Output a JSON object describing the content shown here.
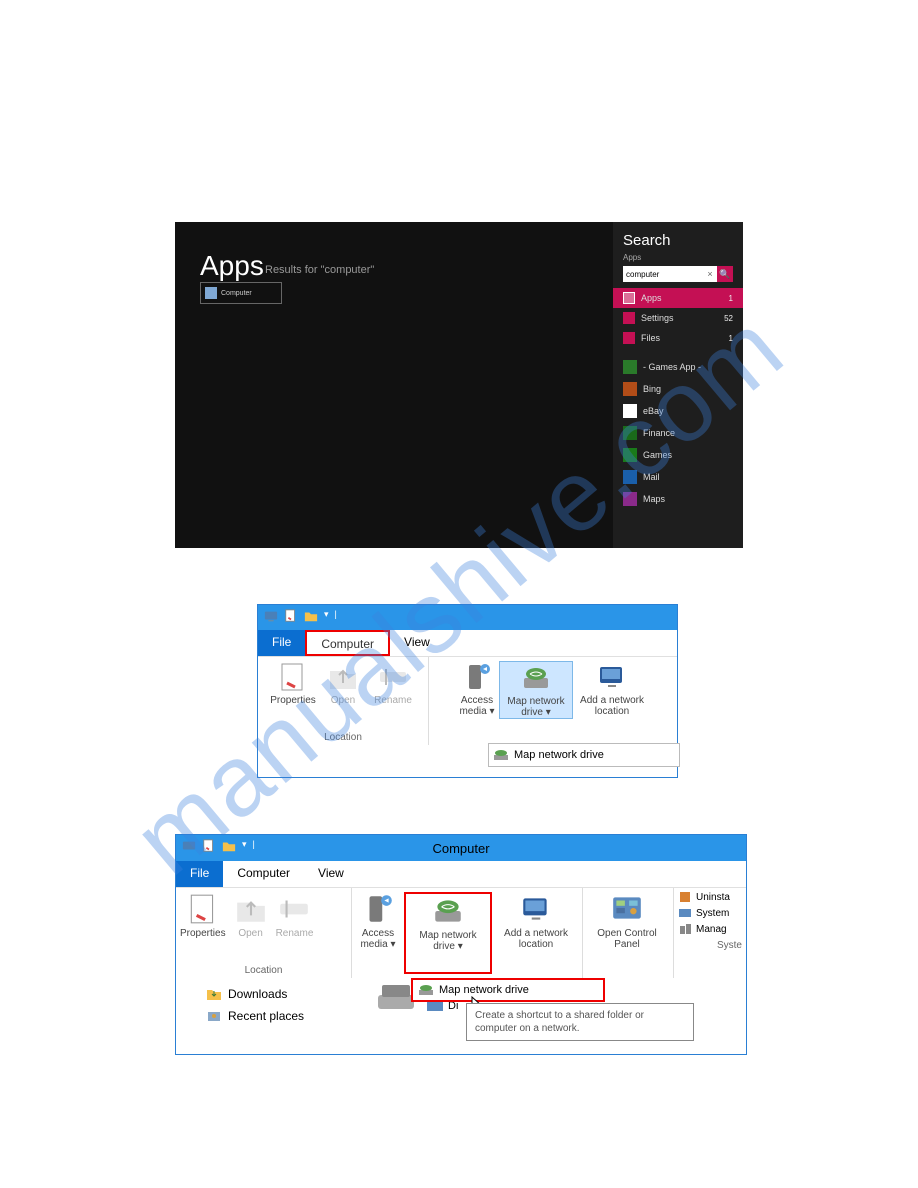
{
  "watermark": "manualshive.com",
  "shot1": {
    "title": "Apps",
    "subtitle": "Results for \"computer\"",
    "tile_label": "Computer",
    "search_header": "Search",
    "search_scope": "Apps",
    "search_value": "computer",
    "categories": [
      {
        "label": "Apps",
        "count": "1",
        "selected": true,
        "color": "#c41054"
      },
      {
        "label": "Settings",
        "count": "52",
        "selected": false,
        "color": "#c41054"
      },
      {
        "label": "Files",
        "count": "1",
        "selected": false,
        "color": "#c41054"
      }
    ],
    "apps": [
      {
        "label": "- Games App -",
        "color": "#2a7a2a"
      },
      {
        "label": "Bing",
        "color": "#b24d18"
      },
      {
        "label": "eBay",
        "color": "#ffffff"
      },
      {
        "label": "Finance",
        "color": "#1a6a1a"
      },
      {
        "label": "Games",
        "color": "#1a7a1a"
      },
      {
        "label": "Mail",
        "color": "#1a5faa"
      },
      {
        "label": "Maps",
        "color": "#8a2a8a"
      }
    ]
  },
  "shot2": {
    "tabs": {
      "file": "File",
      "computer": "Computer",
      "view": "View"
    },
    "group_location": "Location",
    "btn_properties": "Properties",
    "btn_open": "Open",
    "btn_rename": "Rename",
    "btn_access_media": "Access media ▾",
    "btn_map_drive": "Map network drive ▾",
    "btn_add_loc": "Add a network location",
    "dropdown_item": "Map network drive"
  },
  "shot3": {
    "title": "Computer",
    "tabs": {
      "file": "File",
      "computer": "Computer",
      "view": "View"
    },
    "group_location": "Location",
    "group_system": "Syste",
    "btn_properties": "Properties",
    "btn_open": "Open",
    "btn_rename": "Rename",
    "btn_access_media": "Access media ▾",
    "btn_map_drive": "Map network drive ▾",
    "btn_add_loc": "Add a network location",
    "btn_ctrl_panel": "Open Control Panel",
    "small_uninstall": "Uninsta",
    "small_system": "System",
    "small_manage": "Manag",
    "dropdown_item": "Map network drive",
    "nav_downloads": "Downloads",
    "nav_recent": "Recent places",
    "tooltip": "Create a shortcut to a shared folder or computer on a network.",
    "di_label": "Di"
  }
}
